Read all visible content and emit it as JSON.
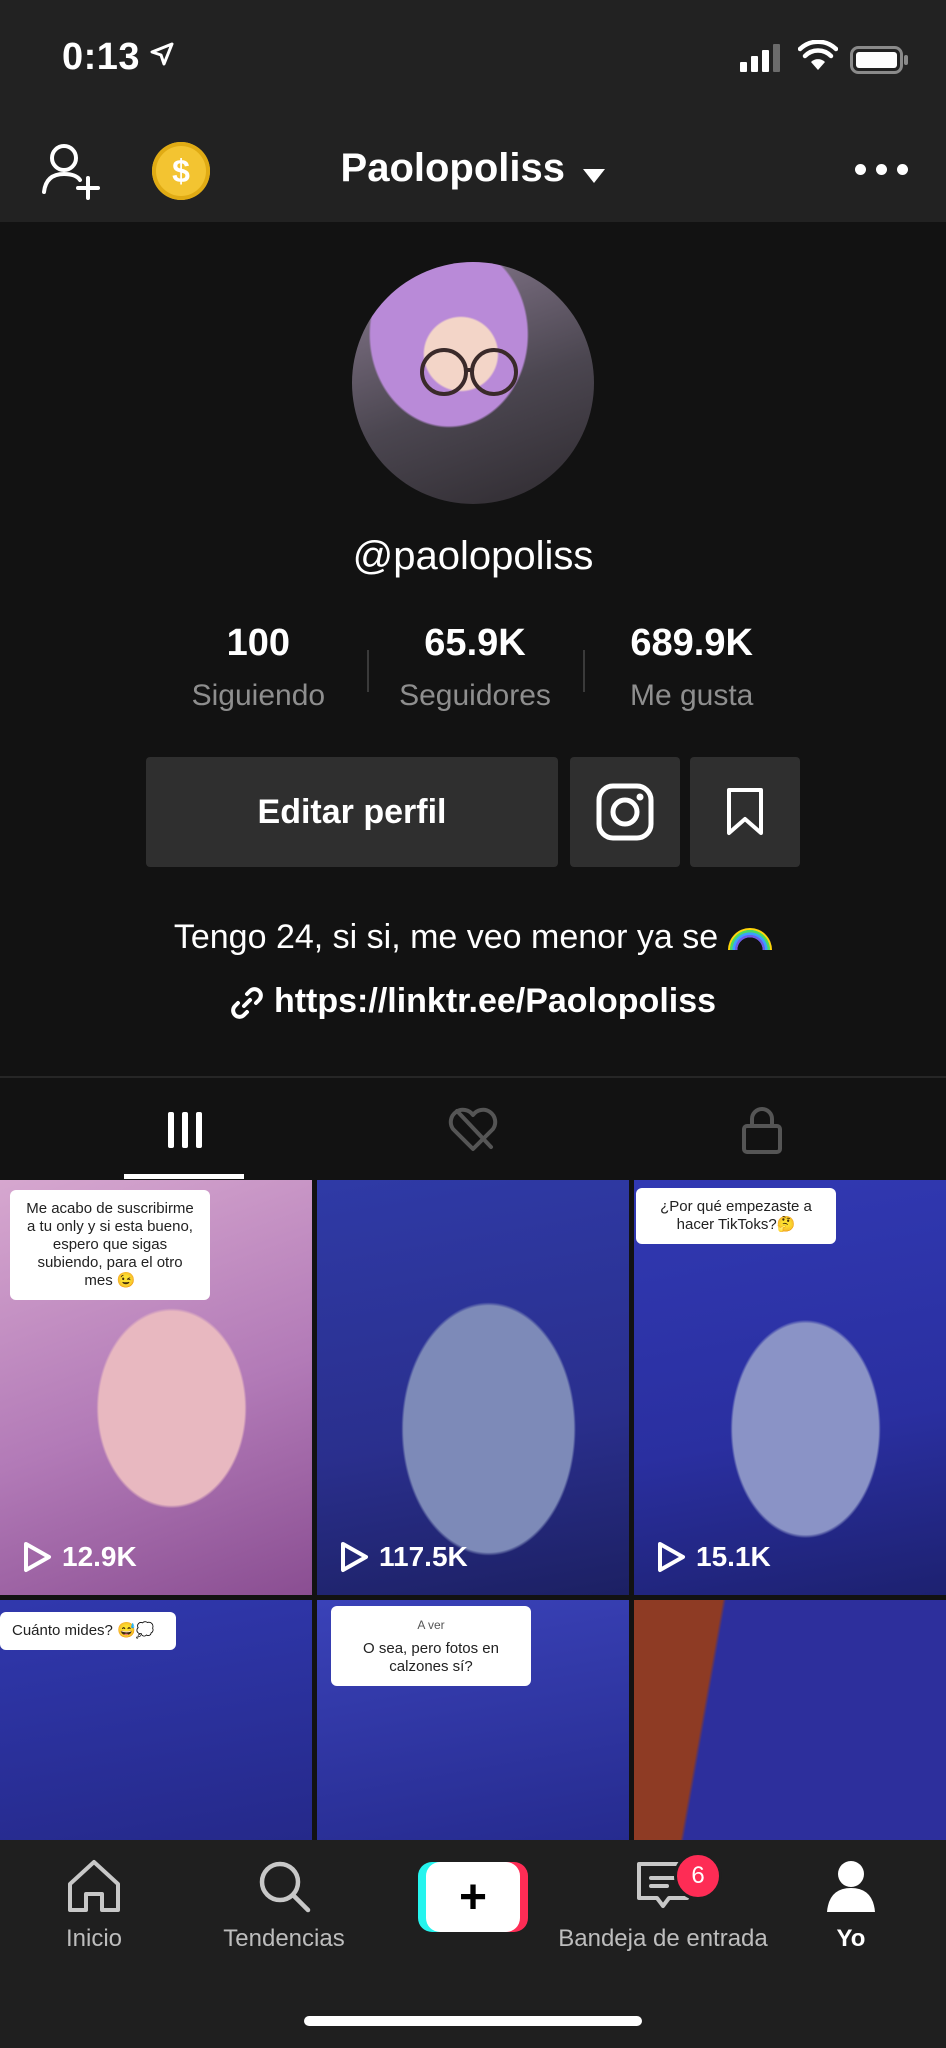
{
  "status_bar": {
    "time": "0:13"
  },
  "header": {
    "account_name": "Paolopoliss"
  },
  "profile": {
    "username": "@paolopoliss",
    "stats": [
      {
        "value": "100",
        "label": "Siguiendo"
      },
      {
        "value": "65.9K",
        "label": "Seguidores"
      },
      {
        "value": "689.9K",
        "label": "Me gusta"
      }
    ],
    "edit_button": "Editar perfil",
    "bio": "Tengo 24, si si, me veo menor ya se",
    "link": "https://linktr.ee/Paolopoliss"
  },
  "videos": [
    {
      "caption": "Me acabo de suscribirme a tu only y si esta bueno, espero que sigas subiendo, para el otro mes 😉",
      "plays": "12.9K"
    },
    {
      "caption": "",
      "plays": "117.5K"
    },
    {
      "caption": "¿Por qué empezaste a hacer TikToks?🤔",
      "plays": "15.1K"
    },
    {
      "caption": "Cuánto mides? 😅💭",
      "plays": ""
    },
    {
      "header": "A ver",
      "caption": "O sea, pero fotos en calzones sí?",
      "plays": ""
    },
    {
      "caption": "",
      "plays": ""
    }
  ],
  "bottom_nav": {
    "items": [
      {
        "label": "Inicio",
        "icon": "home-icon"
      },
      {
        "label": "Tendencias",
        "icon": "search-icon"
      },
      {
        "label": "",
        "icon": "plus-icon"
      },
      {
        "label": "Bandeja de entrada",
        "icon": "inbox-icon"
      },
      {
        "label": "Yo",
        "icon": "profile-icon"
      }
    ],
    "inbox_badge": "6"
  },
  "colors": {
    "background": "#121212",
    "accent_red": "#fe2c55",
    "accent_cyan": "#25f4ee",
    "coin": "#f3c431"
  }
}
